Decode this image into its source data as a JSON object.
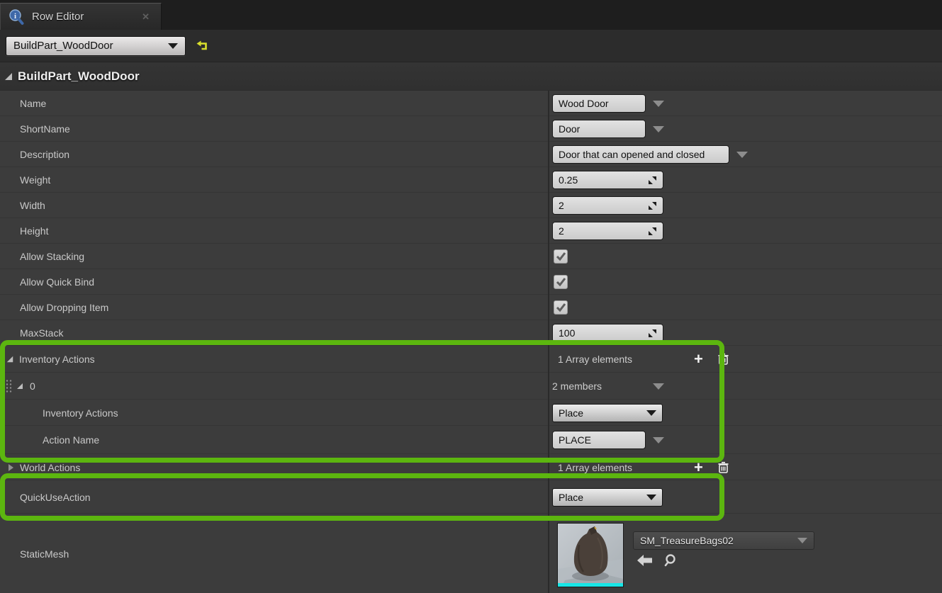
{
  "tab": {
    "title": "Row Editor"
  },
  "toolbar": {
    "selected_row": "BuildPart_WoodDoor"
  },
  "header": {
    "title": "BuildPart_WoodDoor"
  },
  "props": {
    "name": {
      "label": "Name",
      "value": "Wood Door"
    },
    "short_name": {
      "label": "ShortName",
      "value": "Door"
    },
    "description": {
      "label": "Description",
      "value": "Door that can opened and closed"
    },
    "weight": {
      "label": "Weight",
      "value": "0.25"
    },
    "width": {
      "label": "Width",
      "value": "2"
    },
    "height": {
      "label": "Height",
      "value": "2"
    },
    "allow_stacking": {
      "label": "Allow Stacking",
      "checked": true
    },
    "allow_quick_bind": {
      "label": "Allow Quick Bind",
      "checked": true
    },
    "allow_dropping_item": {
      "label": "Allow Dropping Item",
      "checked": true
    },
    "max_stack": {
      "label": "MaxStack",
      "value": "100"
    },
    "inventory_actions": {
      "label": "Inventory Actions",
      "summary": "1 Array elements"
    },
    "element_0": {
      "label": "0",
      "summary": "2 members"
    },
    "inventory_actions_inner": {
      "label": "Inventory Actions",
      "value": "Place"
    },
    "action_name": {
      "label": "Action Name",
      "value": "PLACE"
    },
    "world_actions": {
      "label": "World Actions",
      "summary": "1 Array elements"
    },
    "quick_use_action": {
      "label": "QuickUseAction",
      "value": "Place"
    },
    "static_mesh": {
      "label": "StaticMesh",
      "asset": "SM_TreasureBags02"
    }
  },
  "icons": {
    "close": "✕",
    "plus": "+",
    "check_color": "#5d5d5d"
  },
  "colors": {
    "hl": "#5cb60f",
    "accent": "#17e6e6"
  }
}
